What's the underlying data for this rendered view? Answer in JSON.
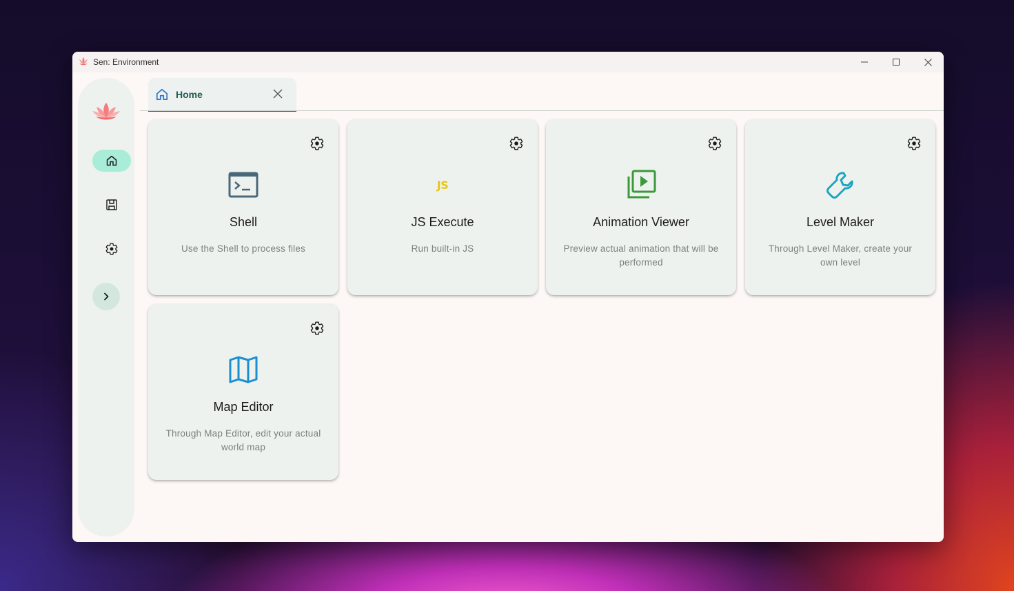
{
  "window": {
    "title": "Sen: Environment"
  },
  "sidebar": {
    "items": [
      {
        "name": "home",
        "icon": "home-icon",
        "active": true
      },
      {
        "name": "saves",
        "icon": "save-icon",
        "active": false
      },
      {
        "name": "settings",
        "icon": "gear-icon",
        "active": false
      }
    ],
    "expand_icon": "chevron-right-icon"
  },
  "tabs": [
    {
      "label": "Home",
      "icon": "home-icon",
      "active": true
    }
  ],
  "cards": [
    {
      "title": "Shell",
      "description": "Use the Shell to process files",
      "icon": "terminal-icon",
      "color": "#4a6878"
    },
    {
      "title": "JS Execute",
      "description": "Run built-in JS",
      "icon": "js-icon",
      "icon_text": "JS",
      "color": "#e8c51a"
    },
    {
      "title": "Animation Viewer",
      "description": "Preview actual animation that will be performed",
      "icon": "video-library-icon",
      "color": "#3a9a3a"
    },
    {
      "title": "Level Maker",
      "description": "Through Level Maker, create your own level",
      "icon": "wrench-icon",
      "color": "#1aa6c0"
    },
    {
      "title": "Map Editor",
      "description": "Through Map Editor, edit your actual world map",
      "icon": "map-icon",
      "color": "#1a8fd0"
    }
  ],
  "colors": {
    "accent": "#2e6b60",
    "nav_active": "#a9ecd8"
  }
}
